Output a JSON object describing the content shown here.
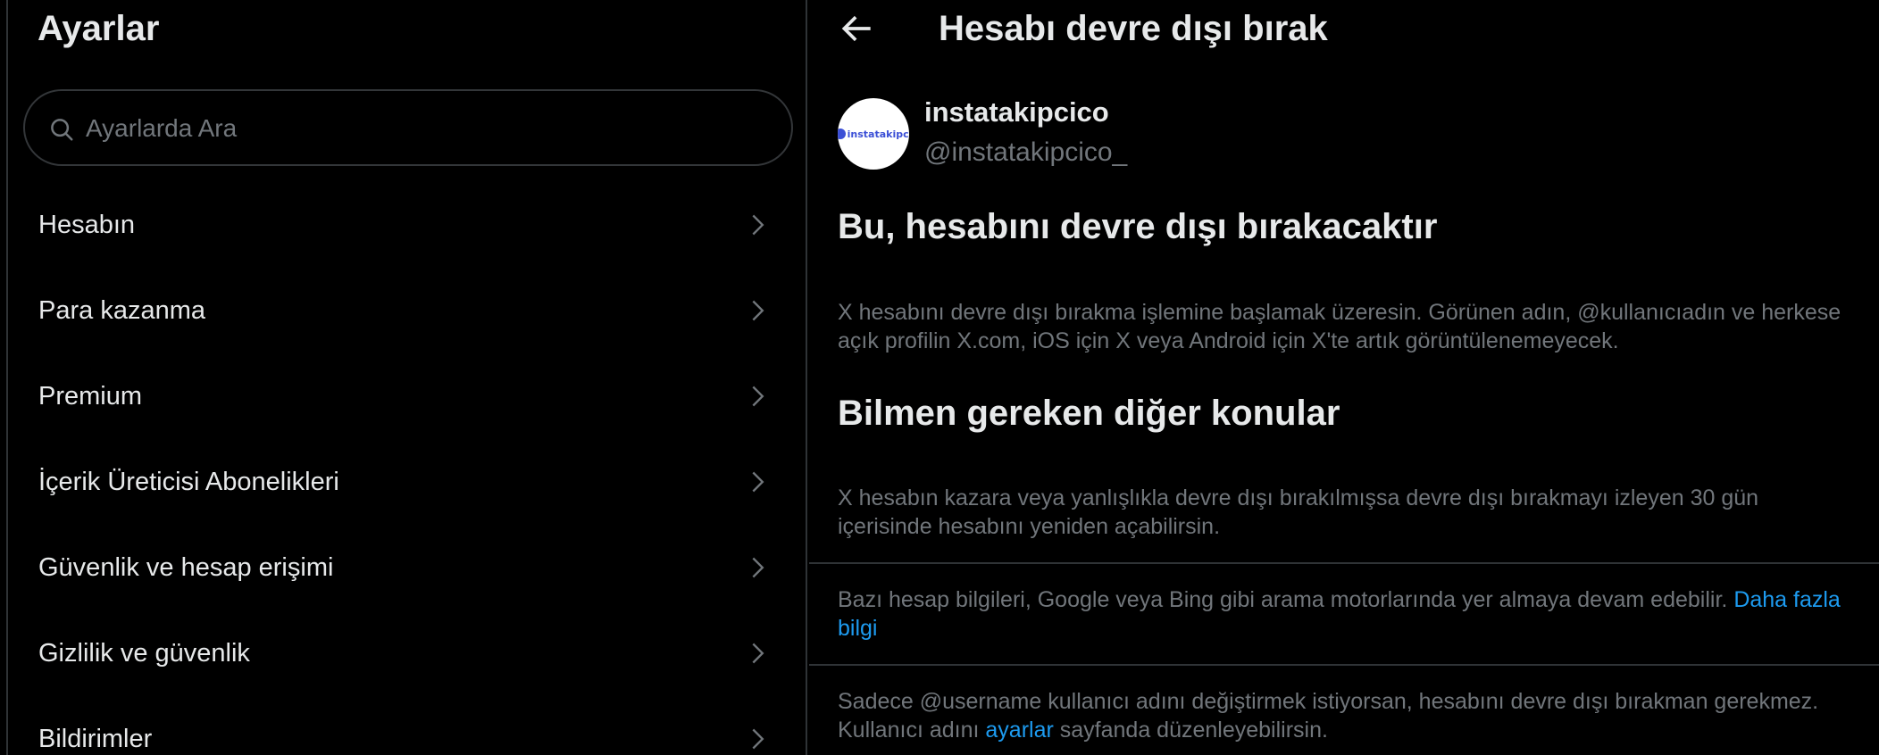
{
  "settings": {
    "title": "Ayarlar",
    "search_placeholder": "Ayarlarda Ara",
    "items": [
      {
        "label": "Hesabın"
      },
      {
        "label": "Para kazanma"
      },
      {
        "label": "Premium"
      },
      {
        "label": "İçerik Üreticisi Abonelikleri"
      },
      {
        "label": "Güvenlik ve hesap erişimi"
      },
      {
        "label": "Gizlilik ve güvenlik"
      },
      {
        "label": "Bildirimler"
      }
    ]
  },
  "deactivate": {
    "title": "Hesabı devre dışı bırak",
    "profile": {
      "display_name": "instatakipcico",
      "handle": "@instatakipcico_",
      "avatar_text": "instatakipci"
    },
    "heading1": "Bu, hesabını devre dışı bırakacaktır",
    "paragraph1": "X hesabını devre dışı bırakma işlemine başlamak üzeresin. Görünen adın, @kullanıcıadın ve herkese açık profilin X.com, iOS için X veya Android için X'te artık görüntülenemeyecek.",
    "heading2": "Bilmen gereken diğer konular",
    "paragraph2": "X hesabın kazara veya yanlışlıkla devre dışı bırakılmışsa devre dışı bırakmayı izleyen 30 gün içerisinde hesabını yeniden açabilirsin.",
    "paragraph3_text": "Bazı hesap bilgileri, Google veya Bing gibi arama motorlarında yer almaya devam edebilir.",
    "paragraph3_link": "Daha fazla bilgi",
    "paragraph4_text_before": "Sadece @username kullanıcı adını değiştirmek istiyorsan, hesabını devre dışı bırakman gerekmez. Kullanıcı adını",
    "paragraph4_link": "ayarlar",
    "paragraph4_text_after": "sayfanda düzenleyebilirsin."
  },
  "colors": {
    "background": "#000000",
    "text_primary": "#e7e9ea",
    "text_secondary": "#71767b",
    "link": "#1d9bf0",
    "border": "#2f3336"
  }
}
